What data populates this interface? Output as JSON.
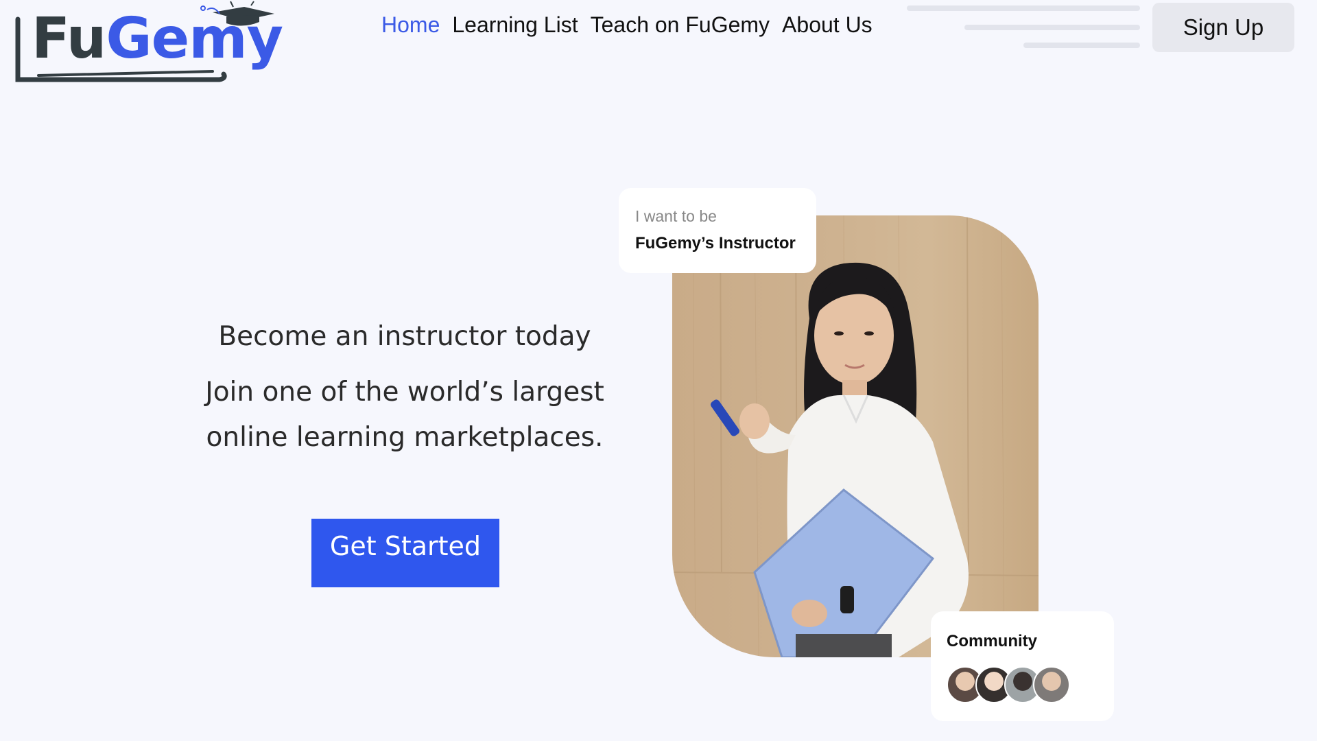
{
  "brand": {
    "logo_part1": "Fu",
    "logo_part2": "Gemy"
  },
  "nav": {
    "items": [
      {
        "label": "Home",
        "active": true
      },
      {
        "label": "Learning List",
        "active": false
      },
      {
        "label": "Teach on FuGemy",
        "active": false
      },
      {
        "label": "About Us",
        "active": false
      }
    ]
  },
  "header": {
    "signup_label": "Sign Up"
  },
  "hero": {
    "title": "Become an instructor today",
    "subtitle_line1": "Join one of the world’s largest",
    "subtitle_line2": "online learning marketplaces.",
    "cta_label": "Get Started"
  },
  "bubble_top": {
    "small": "I want to be",
    "big": "FuGemy’s Instructor"
  },
  "community": {
    "label": "Community",
    "avatars": [
      "avatar-1",
      "avatar-2",
      "avatar-3",
      "avatar-4"
    ]
  },
  "colors": {
    "accent": "#3b5ae6",
    "cta": "#2f57ee",
    "background": "#f6f7fd",
    "logo_dark": "#333d42"
  },
  "icons": [
    "graduation-cap-icon"
  ]
}
